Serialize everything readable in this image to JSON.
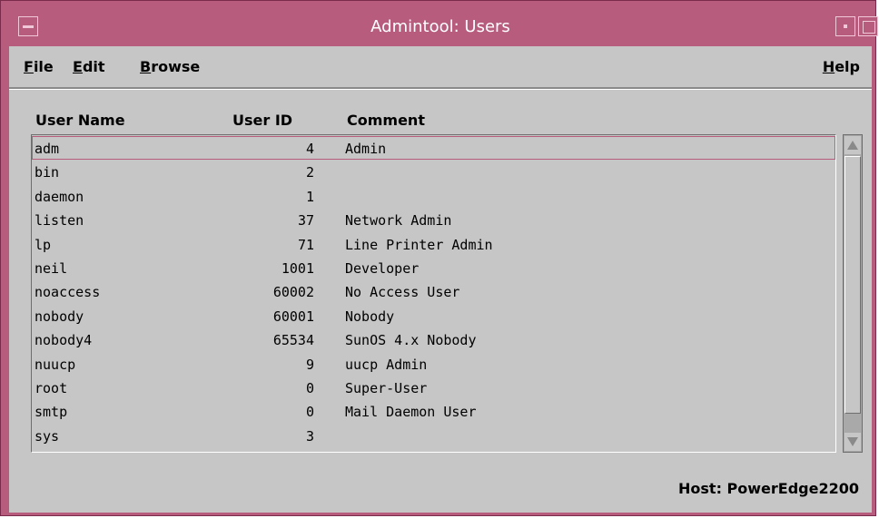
{
  "window": {
    "title": "Admintool: Users",
    "accent_color": "#b75c7d"
  },
  "menubar": {
    "file": {
      "mnemonic": "F",
      "rest": "ile"
    },
    "edit": {
      "mnemonic": "E",
      "rest": "dit"
    },
    "browse": {
      "mnemonic": "B",
      "rest": "rowse"
    },
    "help": {
      "mnemonic": "H",
      "rest": "elp"
    }
  },
  "columns": {
    "user_name": "User Name",
    "user_id": "User ID",
    "comment": "Comment"
  },
  "users": [
    {
      "name": "adm",
      "id": "4",
      "comment": "Admin"
    },
    {
      "name": "bin",
      "id": "2",
      "comment": ""
    },
    {
      "name": "daemon",
      "id": "1",
      "comment": ""
    },
    {
      "name": "listen",
      "id": "37",
      "comment": "Network Admin"
    },
    {
      "name": "lp",
      "id": "71",
      "comment": "Line Printer Admin"
    },
    {
      "name": "neil",
      "id": "1001",
      "comment": "Developer"
    },
    {
      "name": "noaccess",
      "id": "60002",
      "comment": "No Access User"
    },
    {
      "name": "nobody",
      "id": "60001",
      "comment": "Nobody"
    },
    {
      "name": "nobody4",
      "id": "65534",
      "comment": "SunOS 4.x Nobody"
    },
    {
      "name": "nuucp",
      "id": "9",
      "comment": "uucp Admin"
    },
    {
      "name": "root",
      "id": "0",
      "comment": "Super-User"
    },
    {
      "name": "smtp",
      "id": "0",
      "comment": "Mail Daemon User"
    },
    {
      "name": "sys",
      "id": "3",
      "comment": ""
    }
  ],
  "selected_user": "adm",
  "status": {
    "host": "Host: PowerEdge2200"
  }
}
